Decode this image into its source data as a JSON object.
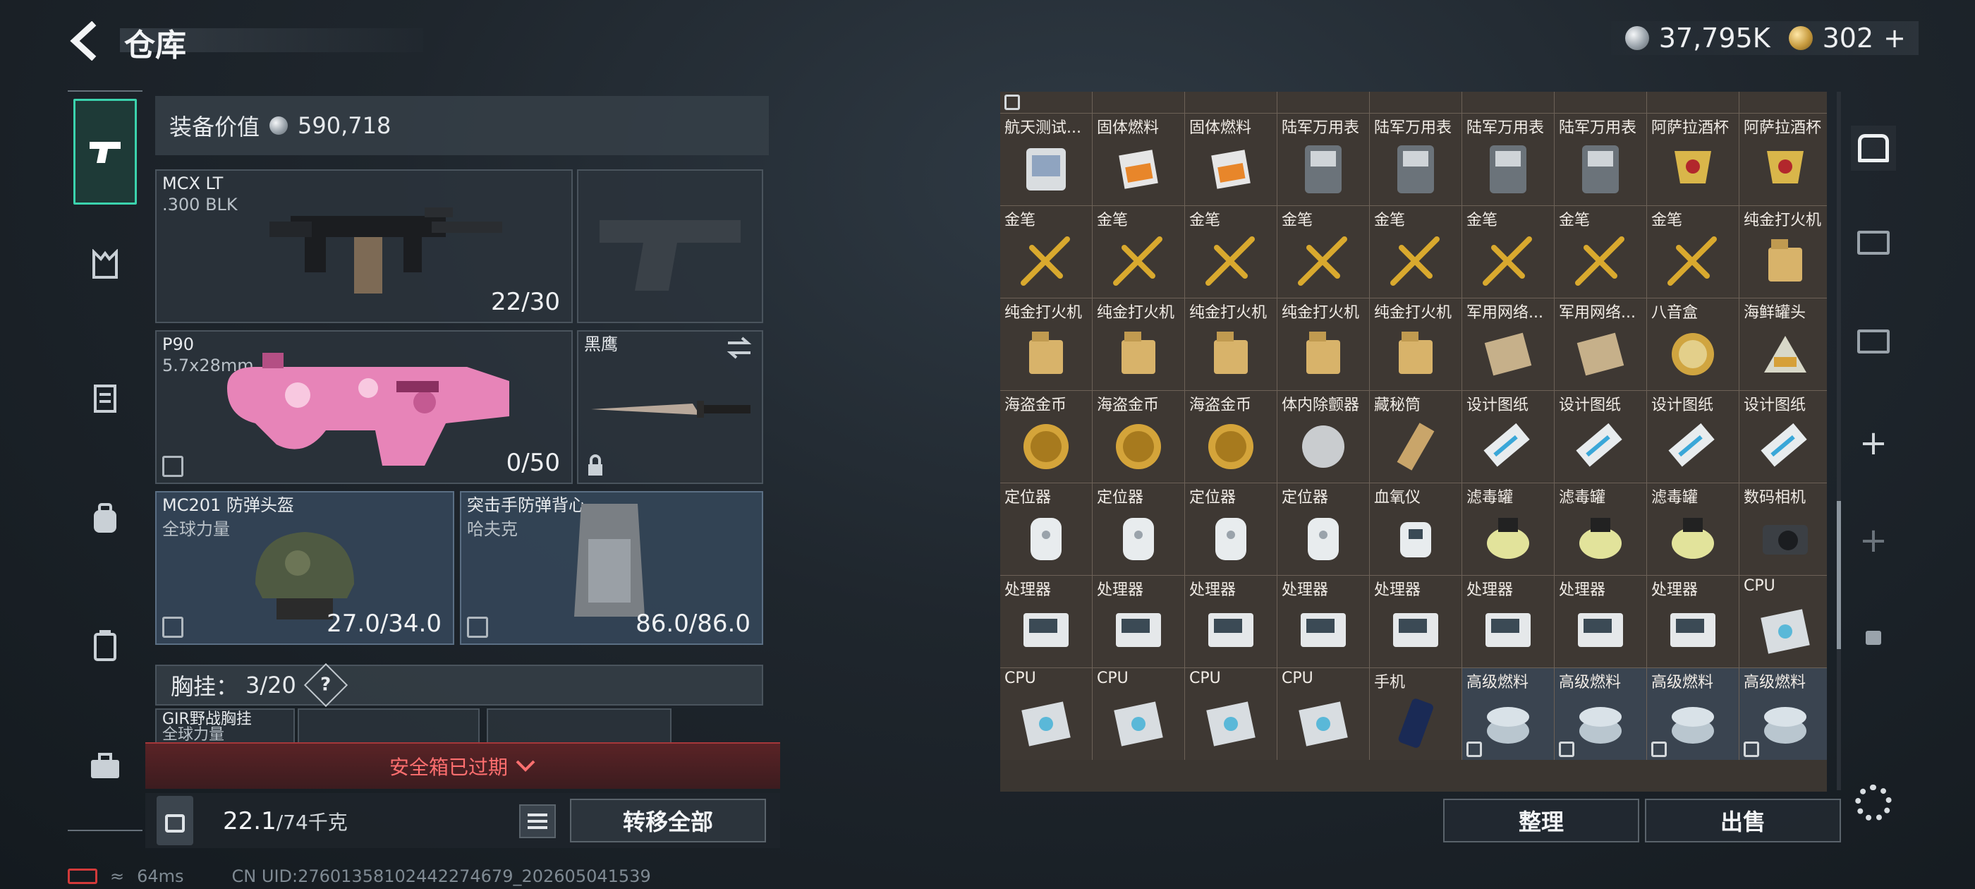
{
  "header": {
    "title": "仓库",
    "silver_amount": "37,795K",
    "gold_amount": "302",
    "gold_plus": "+"
  },
  "equipment": {
    "value_label": "装备价值",
    "value": "590,718",
    "primary_weapon": {
      "name": "MCX LT",
      "caliber": ".300 BLK",
      "ammo": "22/30"
    },
    "secondary_weapon": {
      "name": "P90",
      "caliber": "5.7x28mm",
      "ammo": "0/50"
    },
    "melee": {
      "name": "黑鹰"
    },
    "helmet": {
      "name": "MC201 防弹头盔",
      "sub": "全球力量",
      "durability": "27.0/34.0"
    },
    "armor": {
      "name": "突击手防弹背心",
      "sub": "哈夫克",
      "durability": "86.0/86.0"
    },
    "chest_rig": {
      "label": "胸挂：",
      "count": "3/20",
      "help": "?",
      "item_name": "GIR野战胸挂",
      "item_sub": "全球力量"
    },
    "secure_box_status": "安全箱已过期",
    "capacity": {
      "current": "22.1",
      "max": "/74千克"
    },
    "transfer_all": "转移全部"
  },
  "inventory": {
    "items": [
      {
        "label": "",
        "icon": "mask"
      },
      {
        "label": "",
        "icon": "mask"
      },
      {
        "label": "",
        "icon": "statue"
      },
      {
        "label": "",
        "icon": "statue"
      },
      {
        "label": "",
        "icon": "medal"
      },
      {
        "label": "",
        "icon": "medal"
      },
      {
        "label": "",
        "icon": "device"
      },
      {
        "label": "",
        "icon": "scale"
      },
      {
        "label": "",
        "icon": "scale"
      },
      {
        "label": "航天测试...",
        "icon": "flash-drive"
      },
      {
        "label": "固体燃料",
        "icon": "fuel"
      },
      {
        "label": "固体燃料",
        "icon": "fuel"
      },
      {
        "label": "陆军万用表",
        "icon": "multimeter"
      },
      {
        "label": "陆军万用表",
        "icon": "multimeter"
      },
      {
        "label": "陆军万用表",
        "icon": "multimeter"
      },
      {
        "label": "陆军万用表",
        "icon": "multimeter"
      },
      {
        "label": "阿萨拉酒杯",
        "icon": "cup"
      },
      {
        "label": "阿萨拉酒杯",
        "icon": "cup"
      },
      {
        "label": "金笔",
        "icon": "pen"
      },
      {
        "label": "金笔",
        "icon": "pen"
      },
      {
        "label": "金笔",
        "icon": "pen"
      },
      {
        "label": "金笔",
        "icon": "pen"
      },
      {
        "label": "金笔",
        "icon": "pen"
      },
      {
        "label": "金笔",
        "icon": "pen"
      },
      {
        "label": "金笔",
        "icon": "pen"
      },
      {
        "label": "金笔",
        "icon": "pen"
      },
      {
        "label": "纯金打火机",
        "icon": "lighter"
      },
      {
        "label": "纯金打火机",
        "icon": "lighter"
      },
      {
        "label": "纯金打火机",
        "icon": "lighter"
      },
      {
        "label": "纯金打火机",
        "icon": "lighter"
      },
      {
        "label": "纯金打火机",
        "icon": "lighter"
      },
      {
        "label": "纯金打火机",
        "icon": "lighter"
      },
      {
        "label": "军用网络...",
        "icon": "net-box"
      },
      {
        "label": "军用网络...",
        "icon": "net-box"
      },
      {
        "label": "八音盒",
        "icon": "music-box"
      },
      {
        "label": "海鲜罐头",
        "icon": "can"
      },
      {
        "label": "海盗金币",
        "icon": "coin"
      },
      {
        "label": "海盗金币",
        "icon": "coin"
      },
      {
        "label": "海盗金币",
        "icon": "coin"
      },
      {
        "label": "体内除颤器",
        "icon": "defib"
      },
      {
        "label": "藏秘筒",
        "icon": "cryptex"
      },
      {
        "label": "设计图纸",
        "icon": "blueprint"
      },
      {
        "label": "设计图纸",
        "icon": "blueprint"
      },
      {
        "label": "设计图纸",
        "icon": "blueprint"
      },
      {
        "label": "设计图纸",
        "icon": "blueprint"
      },
      {
        "label": "定位器",
        "icon": "locator"
      },
      {
        "label": "定位器",
        "icon": "locator"
      },
      {
        "label": "定位器",
        "icon": "locator"
      },
      {
        "label": "定位器",
        "icon": "locator"
      },
      {
        "label": "血氧仪",
        "icon": "oximeter"
      },
      {
        "label": "滤毒罐",
        "icon": "filter"
      },
      {
        "label": "滤毒罐",
        "icon": "filter"
      },
      {
        "label": "滤毒罐",
        "icon": "filter"
      },
      {
        "label": "数码相机",
        "icon": "camera"
      },
      {
        "label": "处理器",
        "icon": "processor"
      },
      {
        "label": "处理器",
        "icon": "processor"
      },
      {
        "label": "处理器",
        "icon": "processor"
      },
      {
        "label": "处理器",
        "icon": "processor"
      },
      {
        "label": "处理器",
        "icon": "processor"
      },
      {
        "label": "处理器",
        "icon": "processor"
      },
      {
        "label": "处理器",
        "icon": "processor"
      },
      {
        "label": "处理器",
        "icon": "processor"
      },
      {
        "label": "CPU",
        "icon": "cpu"
      },
      {
        "label": "CPU",
        "icon": "cpu"
      },
      {
        "label": "CPU",
        "icon": "cpu"
      },
      {
        "label": "CPU",
        "icon": "cpu"
      },
      {
        "label": "CPU",
        "icon": "cpu"
      },
      {
        "label": "手机",
        "icon": "phone"
      },
      {
        "label": "高级燃料",
        "icon": "fuel-can"
      },
      {
        "label": "高级燃料",
        "icon": "fuel-can"
      },
      {
        "label": "高级燃料",
        "icon": "fuel-can"
      },
      {
        "label": "高级燃料",
        "icon": "fuel-can"
      }
    ],
    "sort_button": "整理",
    "sell_button": "出售"
  },
  "status_bar": {
    "ping": "64ms",
    "uid": "CN UID:27601358102442274679_202605041539"
  },
  "colors": {
    "accent": "#3bd3ad",
    "warning": "#ff6f6f",
    "gold": "#d4a43a"
  }
}
